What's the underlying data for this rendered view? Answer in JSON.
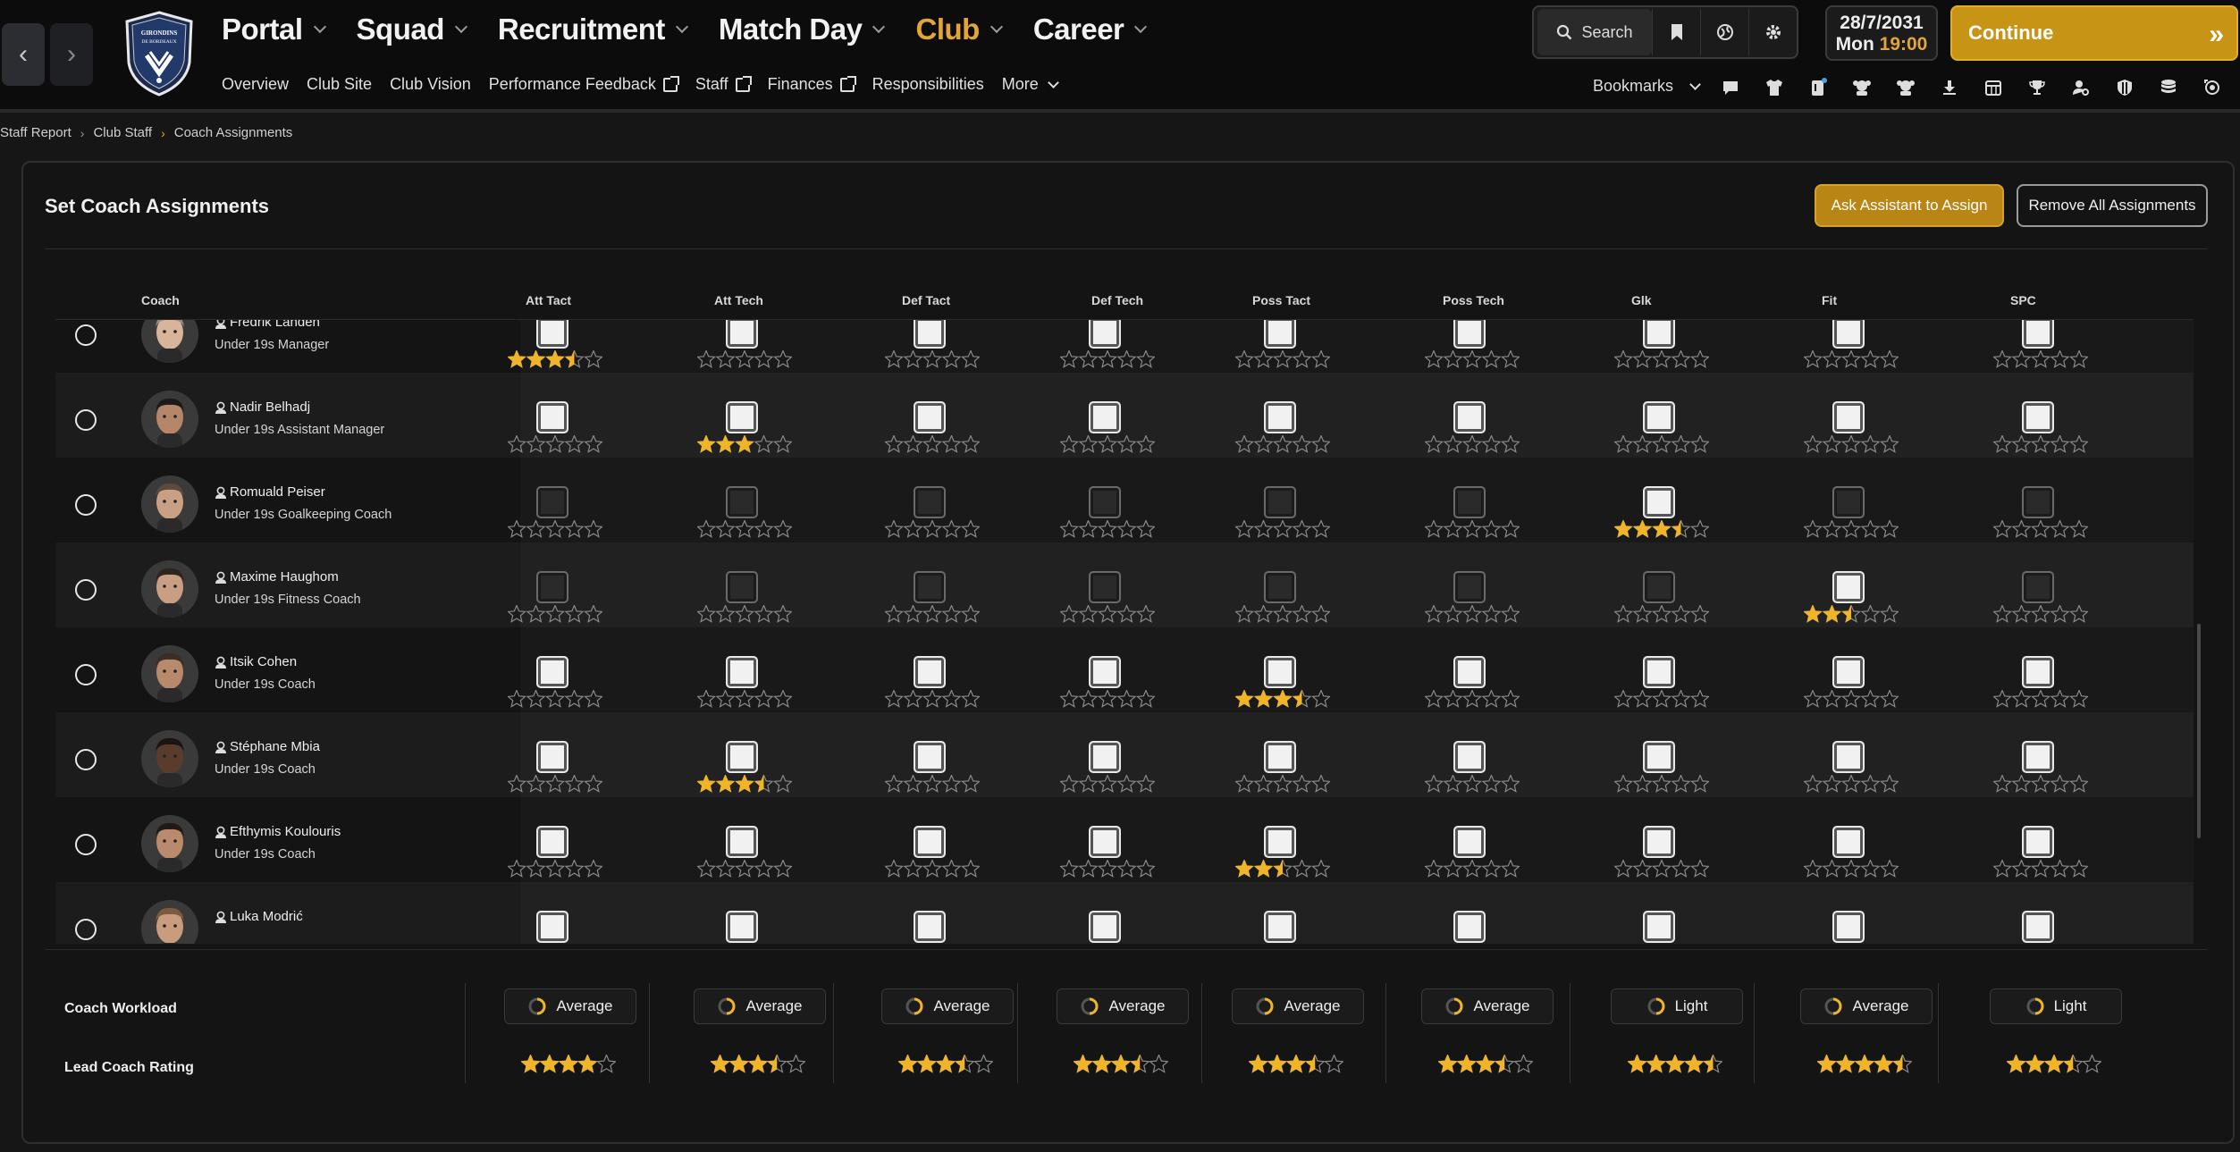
{
  "window": {
    "crest_text": "GIRONDINS DE BORDEAUX"
  },
  "nav": {
    "main": [
      {
        "label": "Portal",
        "active": false
      },
      {
        "label": "Squad",
        "active": false
      },
      {
        "label": "Recruitment",
        "active": false
      },
      {
        "label": "Match Day",
        "active": false
      },
      {
        "label": "Club",
        "active": true
      },
      {
        "label": "Career",
        "active": false
      }
    ],
    "sub": [
      {
        "label": "Overview",
        "external": false
      },
      {
        "label": "Club Site",
        "external": false
      },
      {
        "label": "Club Vision",
        "external": false
      },
      {
        "label": "Performance Feedback",
        "external": true
      },
      {
        "label": "Staff",
        "external": true
      },
      {
        "label": "Finances",
        "external": true
      },
      {
        "label": "Responsibilities",
        "external": false
      }
    ],
    "more_label": "More"
  },
  "toolbar": {
    "search_label": "Search",
    "bookmarks_label": "Bookmarks",
    "continue_label": "Continue"
  },
  "date": {
    "date": "28/7/2031",
    "day": "Mon",
    "time": "19:00"
  },
  "breadcrumb": [
    "Staff Report",
    "Club Staff",
    "Coach Assignments"
  ],
  "panel": {
    "title": "Set Coach Assignments",
    "assign_button": "Ask Assistant to Assign",
    "remove_button": "Remove All Assignments"
  },
  "columns": {
    "coach": "Coach",
    "categories": [
      "Att Tact",
      "Att Tech",
      "Def Tact",
      "Def Tech",
      "Poss Tact",
      "Poss Tech",
      "Glk",
      "Fit",
      "SPC"
    ]
  },
  "coaches": [
    {
      "name": "Fredrik Landén",
      "role": "Under 19s Manager",
      "skin": "#d8b49a",
      "hair": "#9a8b80",
      "enabled": [
        1,
        1,
        1,
        1,
        1,
        1,
        1,
        1,
        1
      ],
      "ratings": [
        3.5,
        0,
        0,
        0,
        0,
        0,
        0,
        0,
        0
      ]
    },
    {
      "name": "Nadir Belhadj",
      "role": "Under 19s Assistant Manager",
      "skin": "#b58668",
      "hair": "#1f1a17",
      "enabled": [
        1,
        1,
        1,
        1,
        1,
        1,
        1,
        1,
        1
      ],
      "ratings": [
        0,
        3,
        0,
        0,
        0,
        0,
        0,
        0,
        0
      ]
    },
    {
      "name": "Romuald Peiser",
      "role": "Under 19s Goalkeeping Coach",
      "skin": "#caa084",
      "hair": "#5c4a3e",
      "enabled": [
        0,
        0,
        0,
        0,
        0,
        0,
        1,
        0,
        0
      ],
      "ratings": [
        0,
        0,
        0,
        0,
        0,
        0,
        3.5,
        0,
        0
      ]
    },
    {
      "name": "Maxime Haughom",
      "role": "Under 19s Fitness Coach",
      "skin": "#c99f83",
      "hair": "#2d2420",
      "enabled": [
        0,
        0,
        0,
        0,
        0,
        0,
        0,
        1,
        0
      ],
      "ratings": [
        0,
        0,
        0,
        0,
        0,
        0,
        0,
        2.5,
        0
      ]
    },
    {
      "name": "Itsik Cohen",
      "role": "Under 19s Coach",
      "skin": "#b8896a",
      "hair": "#3a2e27",
      "enabled": [
        1,
        1,
        1,
        1,
        1,
        1,
        1,
        1,
        1
      ],
      "ratings": [
        0,
        0,
        0,
        0,
        3.5,
        0,
        0,
        0,
        0
      ]
    },
    {
      "name": "Stéphane Mbia",
      "role": "Under 19s Coach",
      "skin": "#5a3c2c",
      "hair": "#1b1412",
      "enabled": [
        1,
        1,
        1,
        1,
        1,
        1,
        1,
        1,
        1
      ],
      "ratings": [
        0,
        3.5,
        0,
        0,
        0,
        0,
        0,
        0,
        0
      ]
    },
    {
      "name": "Efthymis Koulouris",
      "role": "Under 19s Coach",
      "skin": "#b98a6c",
      "hair": "#211915",
      "enabled": [
        1,
        1,
        1,
        1,
        1,
        1,
        1,
        1,
        1
      ],
      "ratings": [
        0,
        0,
        0,
        0,
        2.5,
        0,
        0,
        0,
        0
      ]
    },
    {
      "name": "Luka Modrić",
      "role": "",
      "skin": "#c89c7c",
      "hair": "#7a5a40",
      "enabled": [
        1,
        1,
        1,
        1,
        1,
        1,
        1,
        1,
        1
      ],
      "ratings": [
        0,
        0,
        0,
        0,
        0,
        0,
        0,
        0,
        0
      ]
    }
  ],
  "footer": {
    "workload_label": "Coach Workload",
    "rating_label": "Lead Coach Rating",
    "workloads": [
      "Average",
      "Average",
      "Average",
      "Average",
      "Average",
      "Average",
      "Light",
      "Average",
      "Light"
    ],
    "lead_ratings": [
      4,
      3.5,
      3.5,
      3.5,
      3.5,
      3.5,
      4.5,
      4.5,
      3.5
    ]
  },
  "colors": {
    "accent": "#e3a53a",
    "star": "#f0b429",
    "continue": "#c89416"
  },
  "icons": [
    "search-icon",
    "bookmark-icon",
    "globe-icon",
    "gear-icon",
    "chat-icon",
    "shirt-icon",
    "notes-icon",
    "players-icon",
    "team-icon",
    "download-icon",
    "calendar-icon",
    "trophy-icon",
    "scout-icon",
    "shield-icon",
    "database-icon",
    "target-icon"
  ]
}
